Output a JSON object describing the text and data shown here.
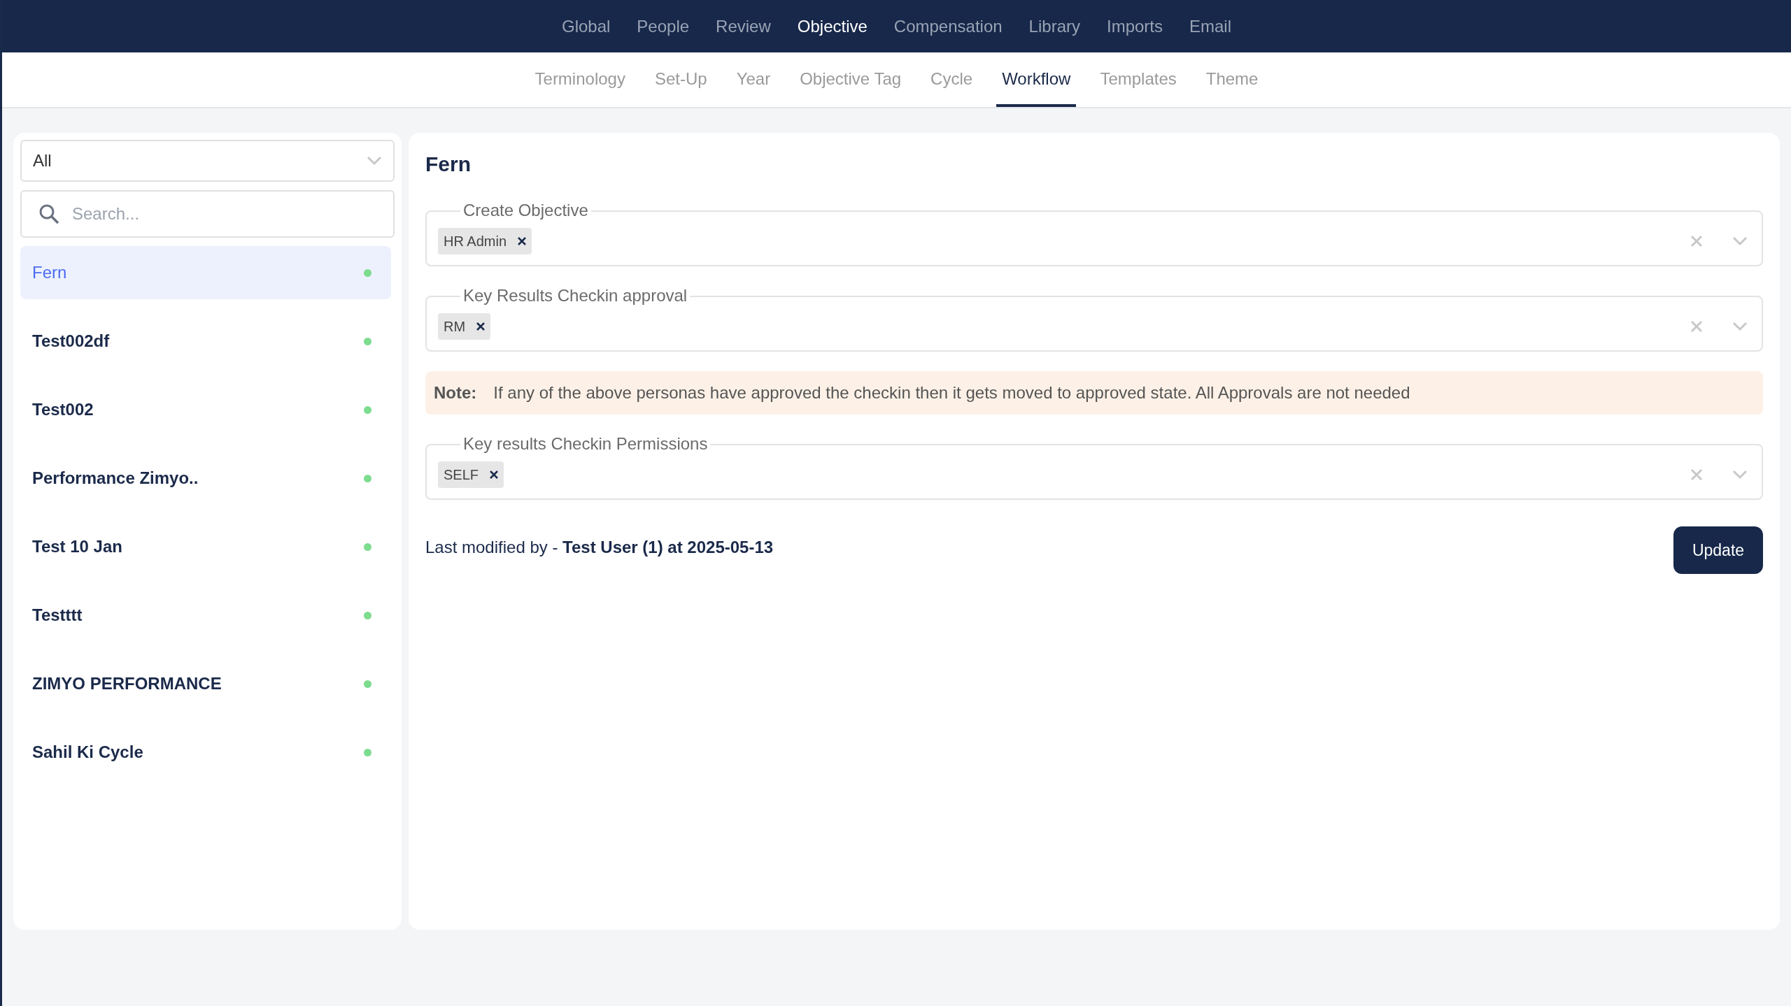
{
  "top_nav": [
    {
      "label": "Global",
      "selected": false
    },
    {
      "label": "People",
      "selected": false
    },
    {
      "label": "Review",
      "selected": false
    },
    {
      "label": "Objective",
      "selected": true
    },
    {
      "label": "Compensation",
      "selected": false
    },
    {
      "label": "Library",
      "selected": false
    },
    {
      "label": "Imports",
      "selected": false
    },
    {
      "label": "Email",
      "selected": false
    }
  ],
  "sub_tabs": [
    {
      "label": "Terminology",
      "selected": false
    },
    {
      "label": "Set-Up",
      "selected": false
    },
    {
      "label": "Year",
      "selected": false
    },
    {
      "label": "Objective Tag",
      "selected": false
    },
    {
      "label": "Cycle",
      "selected": false
    },
    {
      "label": "Workflow",
      "selected": true
    },
    {
      "label": "Templates",
      "selected": false
    },
    {
      "label": "Theme",
      "selected": false
    }
  ],
  "sidebar": {
    "filter": "All",
    "search": {
      "placeholder": "Search..."
    },
    "items": [
      {
        "label": "Fern",
        "selected": true,
        "color": "#7ddc8e"
      },
      {
        "label": "Test002df",
        "selected": false,
        "color": "#7ddc8e"
      },
      {
        "label": "Test002",
        "selected": false,
        "color": "#7ddc8e"
      },
      {
        "label": "Performance Zimyo..",
        "selected": false,
        "color": "#7ddc8e"
      },
      {
        "label": "Test 10 Jan",
        "selected": false,
        "color": "#7ddc8e"
      },
      {
        "label": "Testttt",
        "selected": false,
        "color": "#7ddc8e"
      },
      {
        "label": "ZIMYO PERFORMANCE",
        "selected": false,
        "color": "#7ddc8e"
      },
      {
        "label": "Sahil Ki Cycle",
        "selected": false,
        "color": "#7ddc8e"
      }
    ]
  },
  "detail": {
    "title": "Fern",
    "fields": [
      {
        "kind": "select",
        "label": "Create Objective",
        "chips": [
          "HR Admin"
        ]
      },
      {
        "kind": "select",
        "label": "Key Results Checkin approval",
        "chips": [
          "RM"
        ]
      },
      {
        "kind": "note",
        "label": "Note:",
        "text": "If any of the above personas have approved the checkin then it gets moved to approved state. All Approvals are not needed"
      },
      {
        "kind": "select",
        "label": "Key results Checkin Permissions",
        "chips": [
          "SELF"
        ]
      }
    ],
    "last_modified": "Last modified by - **Test User (1) at 2025-05-13**",
    "update_button": "Update"
  }
}
